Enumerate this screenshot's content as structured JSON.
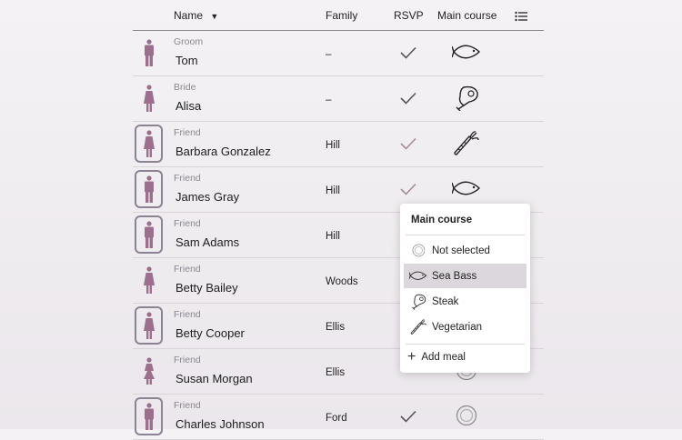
{
  "header": {
    "name_label": "Name",
    "family_label": "Family",
    "rsvp_label": "RSVP",
    "main_course_label": "Main course"
  },
  "guests": [
    {
      "role": "Groom",
      "name": "Tom",
      "family": "–",
      "gender": "male",
      "framed": false,
      "rsvp": true,
      "meal": "fish-icon"
    },
    {
      "role": "Bride",
      "name": "Alisa",
      "family": "–",
      "gender": "female",
      "framed": false,
      "rsvp": true,
      "meal": "steak-icon"
    },
    {
      "role": "Friend",
      "name": "Barbara Gonzalez",
      "family": "Hill",
      "gender": "female",
      "framed": true,
      "rsvp": true,
      "meal": "carrot-icon"
    },
    {
      "role": "Friend",
      "name": "James Gray",
      "family": "Hill",
      "gender": "male",
      "framed": true,
      "rsvp": true,
      "meal": "fish-icon"
    },
    {
      "role": "Friend",
      "name": "Sam Adams",
      "family": "Hill",
      "gender": "male",
      "framed": true,
      "rsvp": false,
      "meal": ""
    },
    {
      "role": "Friend",
      "name": "Betty Bailey",
      "family": "Woods",
      "gender": "female",
      "framed": false,
      "rsvp": false,
      "meal": ""
    },
    {
      "role": "Friend",
      "name": "Betty Cooper",
      "family": "Ellis",
      "gender": "female",
      "framed": true,
      "rsvp": false,
      "meal": ""
    },
    {
      "role": "Friend",
      "name": "Susan Morgan",
      "family": "Ellis",
      "gender": "female-dress",
      "framed": false,
      "rsvp": false,
      "meal": "not-selected-icon"
    },
    {
      "role": "Friend",
      "name": "Charles Johnson",
      "family": "Ford",
      "gender": "male",
      "framed": true,
      "rsvp": true,
      "meal": "not-selected-icon"
    }
  ],
  "dropdown": {
    "title": "Main course",
    "options": [
      {
        "label": "Not selected",
        "icon": "not-selected-icon",
        "selected": false
      },
      {
        "label": "Sea Bass",
        "icon": "fish-icon",
        "selected": true
      },
      {
        "label": "Steak",
        "icon": "steak-icon",
        "selected": false
      },
      {
        "label": "Vegetarian",
        "icon": "carrot-icon",
        "selected": false
      }
    ],
    "add_label": "Add meal"
  },
  "colors": {
    "accent": "#9b6f8d",
    "frame": "#8d8294",
    "selected_bg": "#dcd7dc"
  }
}
